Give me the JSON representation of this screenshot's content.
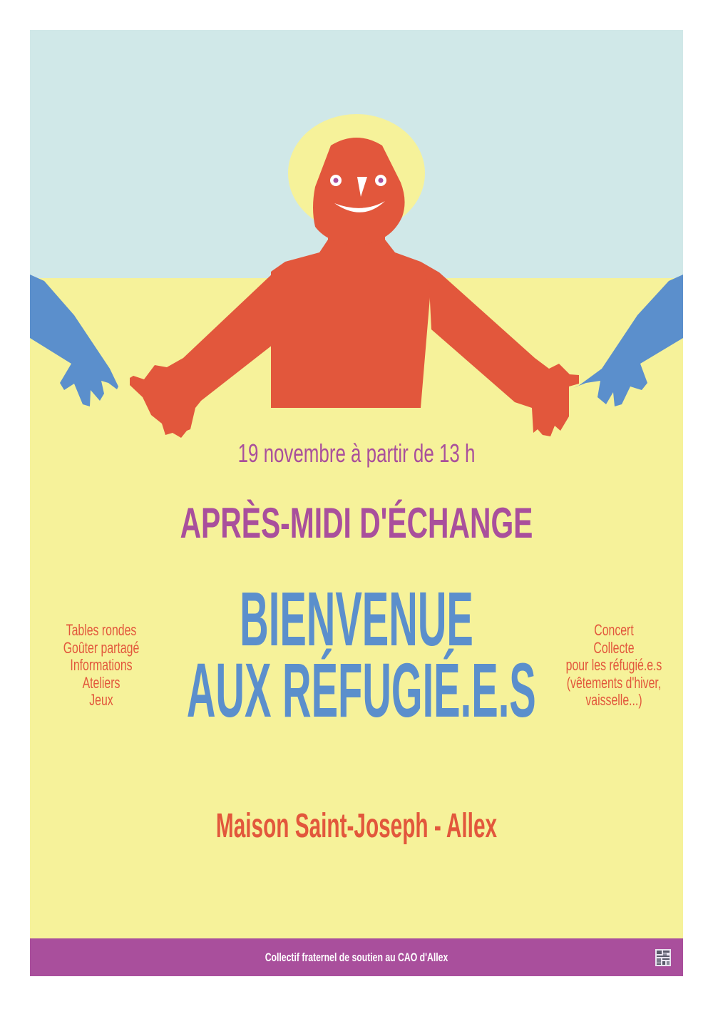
{
  "poster": {
    "date_line": "19 novembre à partir de 13 h",
    "subtitle": "APRÈS-MIDI D'ÉCHANGE",
    "title_line_1": "BIENVENUE",
    "title_line_2": "AUX RÉFUGIÉ.E.S",
    "location": "Maison Saint-Joseph - Allex",
    "left_activities": [
      "Tables rondes",
      "Goûter partagé",
      "Informations",
      "Ateliers",
      "Jeux"
    ],
    "right_activities": [
      "Concert",
      "Collecte",
      "pour les réfugié.e.s",
      "(vêtements d'hiver,",
      "vaisselle...)"
    ],
    "footer_text": "Collectif fraternel de soutien au CAO d'Allex"
  },
  "colors": {
    "sky": "#d0e8e8",
    "background": "#f6f29a",
    "figure": "#e2573c",
    "halo": "#f6f29a",
    "hands": "#5b8fcc",
    "purple": "#a94f9c",
    "blue_title": "#5b8fcc",
    "orange_text": "#e2573c"
  },
  "illustration": {
    "figure": "smiling-person-open-arms",
    "side_elements": "welcoming-blue-hands"
  }
}
